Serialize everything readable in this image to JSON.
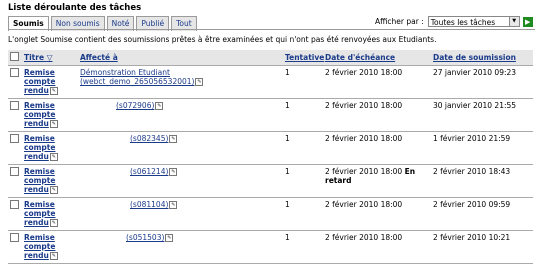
{
  "page": {
    "title": "Liste déroulante des tâches",
    "description": "L'onglet Soumise contient des soumissions prêtes à être examinées et qui n'ont pas été renvoyées aux Etudiants."
  },
  "tabs": [
    {
      "label": "Soumis",
      "active": true
    },
    {
      "label": "Non soumis",
      "active": false
    },
    {
      "label": "Noté",
      "active": false
    },
    {
      "label": "Publié",
      "active": false
    },
    {
      "label": "Tout",
      "active": false
    }
  ],
  "view_by": {
    "label": "Afficher par :",
    "selected": "Toutes les tâches"
  },
  "table": {
    "headers": [
      "Titre",
      "Affecté à",
      "Tentative",
      "Date d'échéance",
      "Date de soumission"
    ],
    "rows": [
      {
        "title": "Remise compte rendu",
        "assignee": "Démonstration Etudiant (webct_demo_265056532001)",
        "attempt": "1",
        "due": "2 février 2010 18:00",
        "late": "",
        "submitted": "27 janvier 2010 09:23"
      },
      {
        "title": "Remise compte rendu",
        "assignee": "(s072906)",
        "attempt": "1",
        "due": "2 février 2010 18:00",
        "late": "",
        "submitted": "30 janvier 2010 21:55"
      },
      {
        "title": "Remise compte rendu",
        "assignee": "(s082345)",
        "attempt": "1",
        "due": "2 février 2010 18:00",
        "late": "",
        "submitted": "1 février 2010 21:59"
      },
      {
        "title": "Remise compte rendu",
        "assignee": "(s061214)",
        "attempt": "1",
        "due": "2 février 2010 18:00",
        "late": "En retard",
        "submitted": "2 février 2010 18:43"
      },
      {
        "title": "Remise compte rendu",
        "assignee": "(s081104)",
        "attempt": "1",
        "due": "2 février 2010 18:00",
        "late": "",
        "submitted": "2 février 2010 09:59"
      },
      {
        "title": "Remise compte rendu",
        "assignee": "(s051503)",
        "attempt": "1",
        "due": "2 février 2010 18:00",
        "late": "",
        "submitted": "2 février 2010 10:21"
      }
    ]
  }
}
